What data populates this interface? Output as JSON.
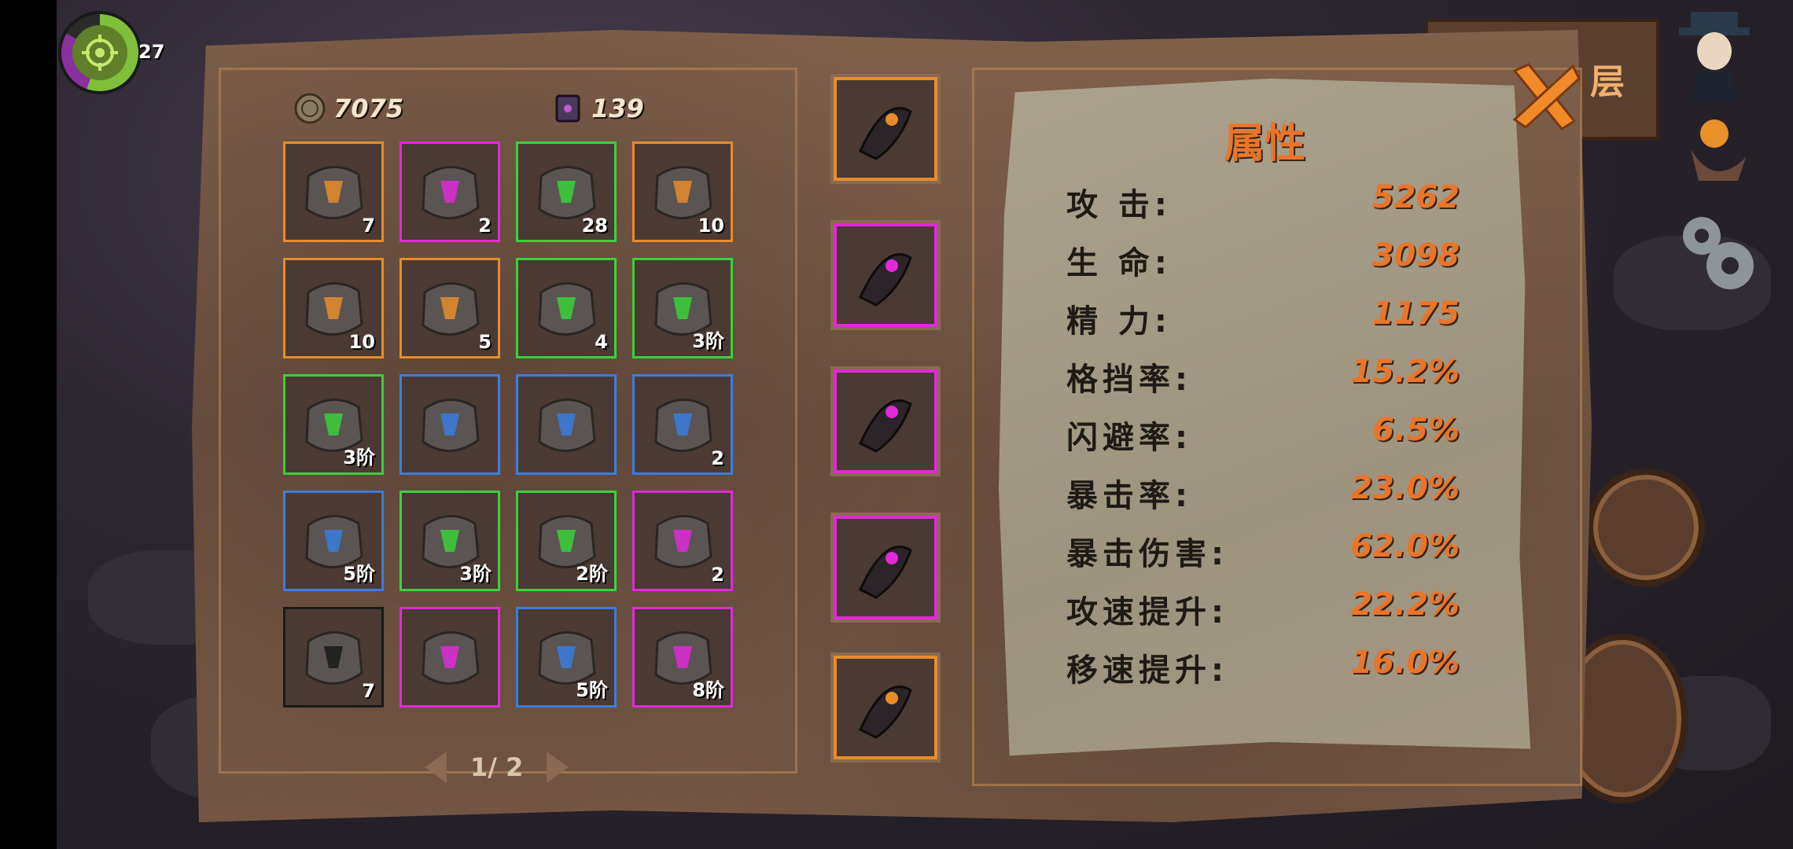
{
  "hud": {
    "level": "27"
  },
  "currency": [
    {
      "icon": "coin-icon",
      "value": "7075"
    },
    {
      "icon": "spellbook-icon",
      "value": "139"
    }
  ],
  "inventory": [
    {
      "icon": "hero-portrait-piece-icon",
      "quality": "orange",
      "qty": "7"
    },
    {
      "icon": "dark-spiked-ring-icon",
      "quality": "purple",
      "qty": "2"
    },
    {
      "icon": "christmas-gift-icon",
      "quality": "green",
      "qty": "28"
    },
    {
      "icon": "green-spear-scroll-icon",
      "quality": "orange",
      "qty": "10"
    },
    {
      "icon": "golden-sword-scroll-icon",
      "quality": "orange",
      "qty": "10"
    },
    {
      "icon": "red-staff-scroll-icon",
      "quality": "orange",
      "qty": "5"
    },
    {
      "icon": "santa-portrait-piece-icon",
      "quality": "green",
      "qty": "4"
    },
    {
      "icon": "cyan-rune-stone-icon",
      "quality": "green",
      "qty": "3阶"
    },
    {
      "icon": "purple-bird-rune-stone-icon",
      "quality": "green",
      "qty": "3阶"
    },
    {
      "icon": "dark-pillar-rune-stone-icon",
      "quality": "blue",
      "qty": ""
    },
    {
      "icon": "mask-rune-stone-icon",
      "quality": "blue",
      "qty": ""
    },
    {
      "icon": "crystal-shard-icon",
      "quality": "blue",
      "qty": "2"
    },
    {
      "icon": "red-tree-rune-stone-icon",
      "quality": "blue",
      "qty": "5阶"
    },
    {
      "icon": "orange-heart-rune-stone-icon",
      "quality": "green",
      "qty": "3阶"
    },
    {
      "icon": "yellow-tree-rune-stone-icon",
      "quality": "green",
      "qty": "2阶"
    },
    {
      "icon": "berry-jar-icon",
      "quality": "purple",
      "qty": "2"
    },
    {
      "icon": "red-potion-icon",
      "quality": "black",
      "qty": "7"
    },
    {
      "icon": "cyan-glow-rune-icon",
      "quality": "purple",
      "qty": ""
    },
    {
      "icon": "orange-maw-rune-stone-icon",
      "quality": "blue",
      "qty": "5阶"
    },
    {
      "icon": "green-leaf-rune-stone-icon",
      "quality": "purple",
      "qty": "8阶"
    }
  ],
  "pager": {
    "text": "1/ 2"
  },
  "equipment": [
    {
      "icon": "staff-icon",
      "quality": "orange"
    },
    {
      "icon": "dark-cloak-icon",
      "quality": "purple"
    },
    {
      "icon": "feathered-hat-icon",
      "quality": "purple"
    },
    {
      "icon": "dark-armor-icon",
      "quality": "purple"
    },
    {
      "icon": "boots-icon",
      "quality": "orange"
    }
  ],
  "stats": {
    "title": "属性",
    "rows": [
      {
        "label": "攻  击:",
        "value": "5262"
      },
      {
        "label": "生  命:",
        "value": "3098"
      },
      {
        "label": "精  力:",
        "value": "1175"
      },
      {
        "label": "格挡率:",
        "value": "15.2%"
      },
      {
        "label": "闪避率:",
        "value": "6.5%"
      },
      {
        "label": "暴击率:",
        "value": "23.0%"
      },
      {
        "label": "暴击伤害:",
        "value": "62.0%"
      },
      {
        "label": "攻速提升:",
        "value": "22.2%"
      },
      {
        "label": "移速提升:",
        "value": "16.0%"
      }
    ]
  },
  "right_hud": {
    "floor_button": "层"
  },
  "colors": {
    "orange": "#e88c2a",
    "purple": "#e02ad8",
    "green": "#3bd13b",
    "blue": "#3a7de0",
    "black": "#1a1a1a",
    "stat_value": "#e8752a"
  }
}
